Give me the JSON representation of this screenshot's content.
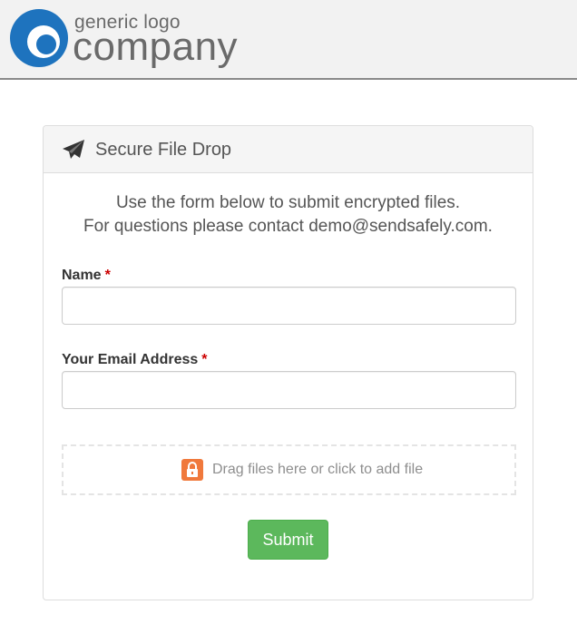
{
  "header": {
    "logo_small": "generic logo",
    "logo_big": "company",
    "logo_color": "#1e73be"
  },
  "panel": {
    "title": "Secure File Drop",
    "title_icon": "paper-plane-icon",
    "intro_line1": "Use the form below to submit encrypted files.",
    "intro_line2": "For questions please contact demo@sendsafely.com."
  },
  "form": {
    "name_label": "Name",
    "name_value": "",
    "email_label": "Your Email Address",
    "email_value": "",
    "required_marker": "*",
    "dropzone_icon": "lock-icon",
    "dropzone_text": "Drag files here or click to add file",
    "submit_label": "Submit",
    "submit_color": "#5cb85c",
    "lock_color": "#f0793c"
  }
}
